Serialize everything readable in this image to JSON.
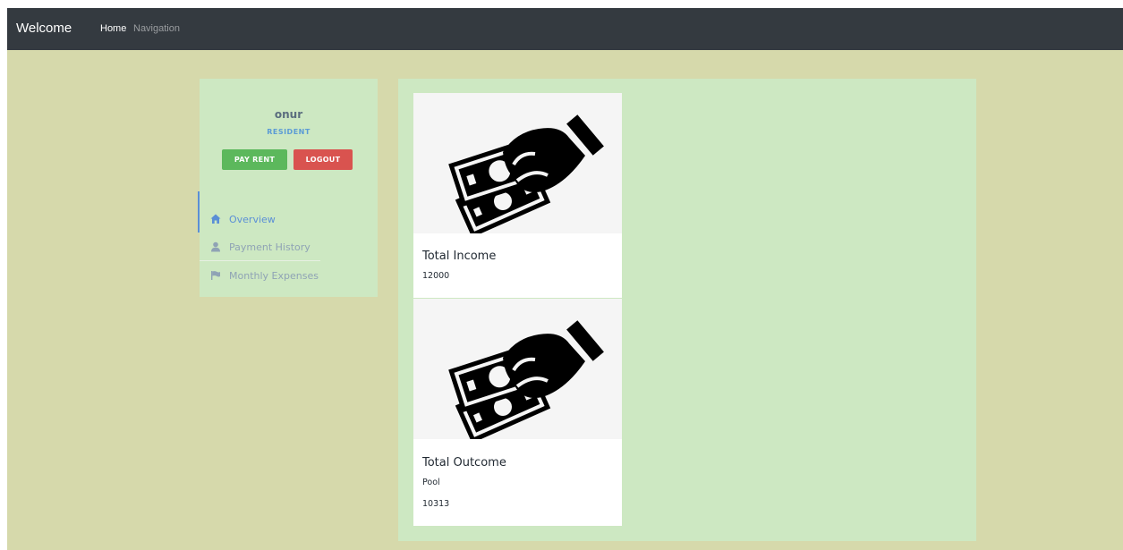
{
  "navbar": {
    "brand": "Welcome",
    "home": "Home",
    "navigation": "Navigation"
  },
  "profile": {
    "name": "onur",
    "role": "RESIDENT",
    "pay_rent_label": "PAY RENT",
    "logout_label": "LOGOUT"
  },
  "menu": {
    "items": [
      {
        "label": "Overview",
        "icon": "home-icon",
        "active": true
      },
      {
        "label": "Payment History",
        "icon": "user-icon",
        "active": false
      },
      {
        "label": "Monthly Expenses",
        "icon": "flag-icon",
        "active": false
      }
    ]
  },
  "cards": [
    {
      "title": "Total Income",
      "value": "12000",
      "icon": "money-hand-icon"
    },
    {
      "title": "Total Outcome",
      "subtitle": "Pool",
      "value": "10313",
      "icon": "money-hand-icon"
    }
  ],
  "colors": {
    "background": "#d6d9ab",
    "panel": "#cde8c2",
    "navbar": "#343a40",
    "accent": "#5b8fd6",
    "pay_button": "#5cb85c",
    "logout_button": "#d9534f"
  }
}
